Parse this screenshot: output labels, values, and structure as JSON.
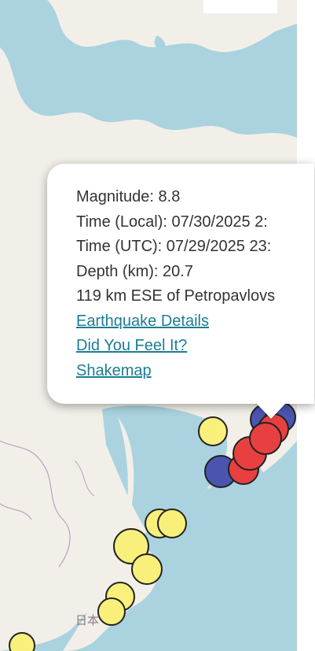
{
  "map": {
    "label": "日本",
    "colors": {
      "water": "#aad3df",
      "land": "#f2efe9",
      "border": "#b5a3c2",
      "marker_yellow": "#f8f07a",
      "marker_red": "#e84040",
      "marker_blue": "#4a55b0",
      "marker_stroke": "#222222"
    },
    "markers": [
      {
        "color": "yellow",
        "name": "marker-yellow-1"
      },
      {
        "color": "blue",
        "name": "marker-blue-1"
      },
      {
        "color": "blue",
        "name": "marker-blue-2"
      },
      {
        "color": "red",
        "name": "marker-red-1"
      },
      {
        "color": "red",
        "name": "marker-red-2"
      },
      {
        "color": "red",
        "name": "marker-red-3"
      },
      {
        "color": "red",
        "name": "marker-red-4"
      },
      {
        "color": "blue",
        "name": "marker-blue-3"
      },
      {
        "color": "yellow",
        "name": "marker-yellow-2"
      },
      {
        "color": "yellow",
        "name": "marker-yellow-3"
      },
      {
        "color": "yellow",
        "name": "marker-yellow-4"
      },
      {
        "color": "yellow",
        "name": "marker-yellow-5"
      },
      {
        "color": "yellow",
        "name": "marker-yellow-6"
      },
      {
        "color": "yellow",
        "name": "marker-yellow-7"
      },
      {
        "color": "yellow",
        "name": "marker-yellow-8"
      }
    ]
  },
  "popup": {
    "magnitude": "Magnitude: 8.8",
    "time_local": "Time (Local): 07/30/2025 2:",
    "time_utc": "Time (UTC): 07/29/2025 23:",
    "depth": "Depth (km): 20.7",
    "location": "119 km ESE of Petropavlovs",
    "links": {
      "details": "Earthquake Details",
      "felt": "Did You Feel It?",
      "shakemap": "Shakemap"
    }
  }
}
